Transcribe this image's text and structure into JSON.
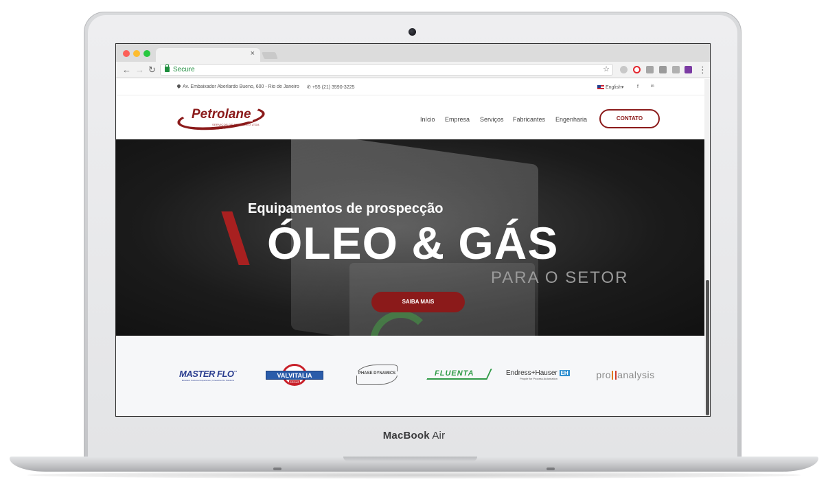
{
  "device": {
    "brand_bold": "MacBook",
    "brand_light": "Air"
  },
  "browser": {
    "secure_label": "Secure",
    "tab_close_glyph": "×",
    "back_glyph": "←",
    "forward_glyph": "→",
    "reload_glyph": "↻",
    "star_glyph": "☆",
    "menu_glyph": "⋮"
  },
  "site": {
    "topbar": {
      "address": "Av. Embaixador Aberlardo Bueno, 600 - Rio de Janeiro",
      "phone": "+55 (21) 3590-3225",
      "language": "English",
      "language_caret": "▾",
      "facebook": "f",
      "linkedin": "in"
    },
    "logo": {
      "name": "Petrolane",
      "tagline": "SERVIÇOS DE PETRÓLEO LTDA"
    },
    "nav": [
      "Início",
      "Empresa",
      "Serviços",
      "Fabricantes",
      "Engenharia"
    ],
    "cta": "CONTATO",
    "hero": {
      "subtitle": "Equipamentos de prospecção",
      "title": "ÓLEO & GÁS",
      "tail": "PARA O SETOR",
      "button": "SAIBA MAIS"
    },
    "partners": {
      "masterflo": {
        "name": "MASTER FLO",
        "tm": "™",
        "sub": "Excellent Customer Experience | Innovative Flo Solutions"
      },
      "valvitalia": {
        "name": "VALVITALIA",
        "sub": "GROUP"
      },
      "phase": {
        "name": "PHASE DYNAMICS"
      },
      "fluenta": {
        "name": "FLUENTA"
      },
      "endress": {
        "name": "Endress+Hauser",
        "mark": "EH",
        "sub": "People for Process Automation"
      },
      "proanalysis": {
        "name_a": "pro",
        "name_b": "analysis"
      }
    }
  },
  "colors": {
    "brand": "#8b1a1a",
    "secure": "#1e8e3e"
  }
}
